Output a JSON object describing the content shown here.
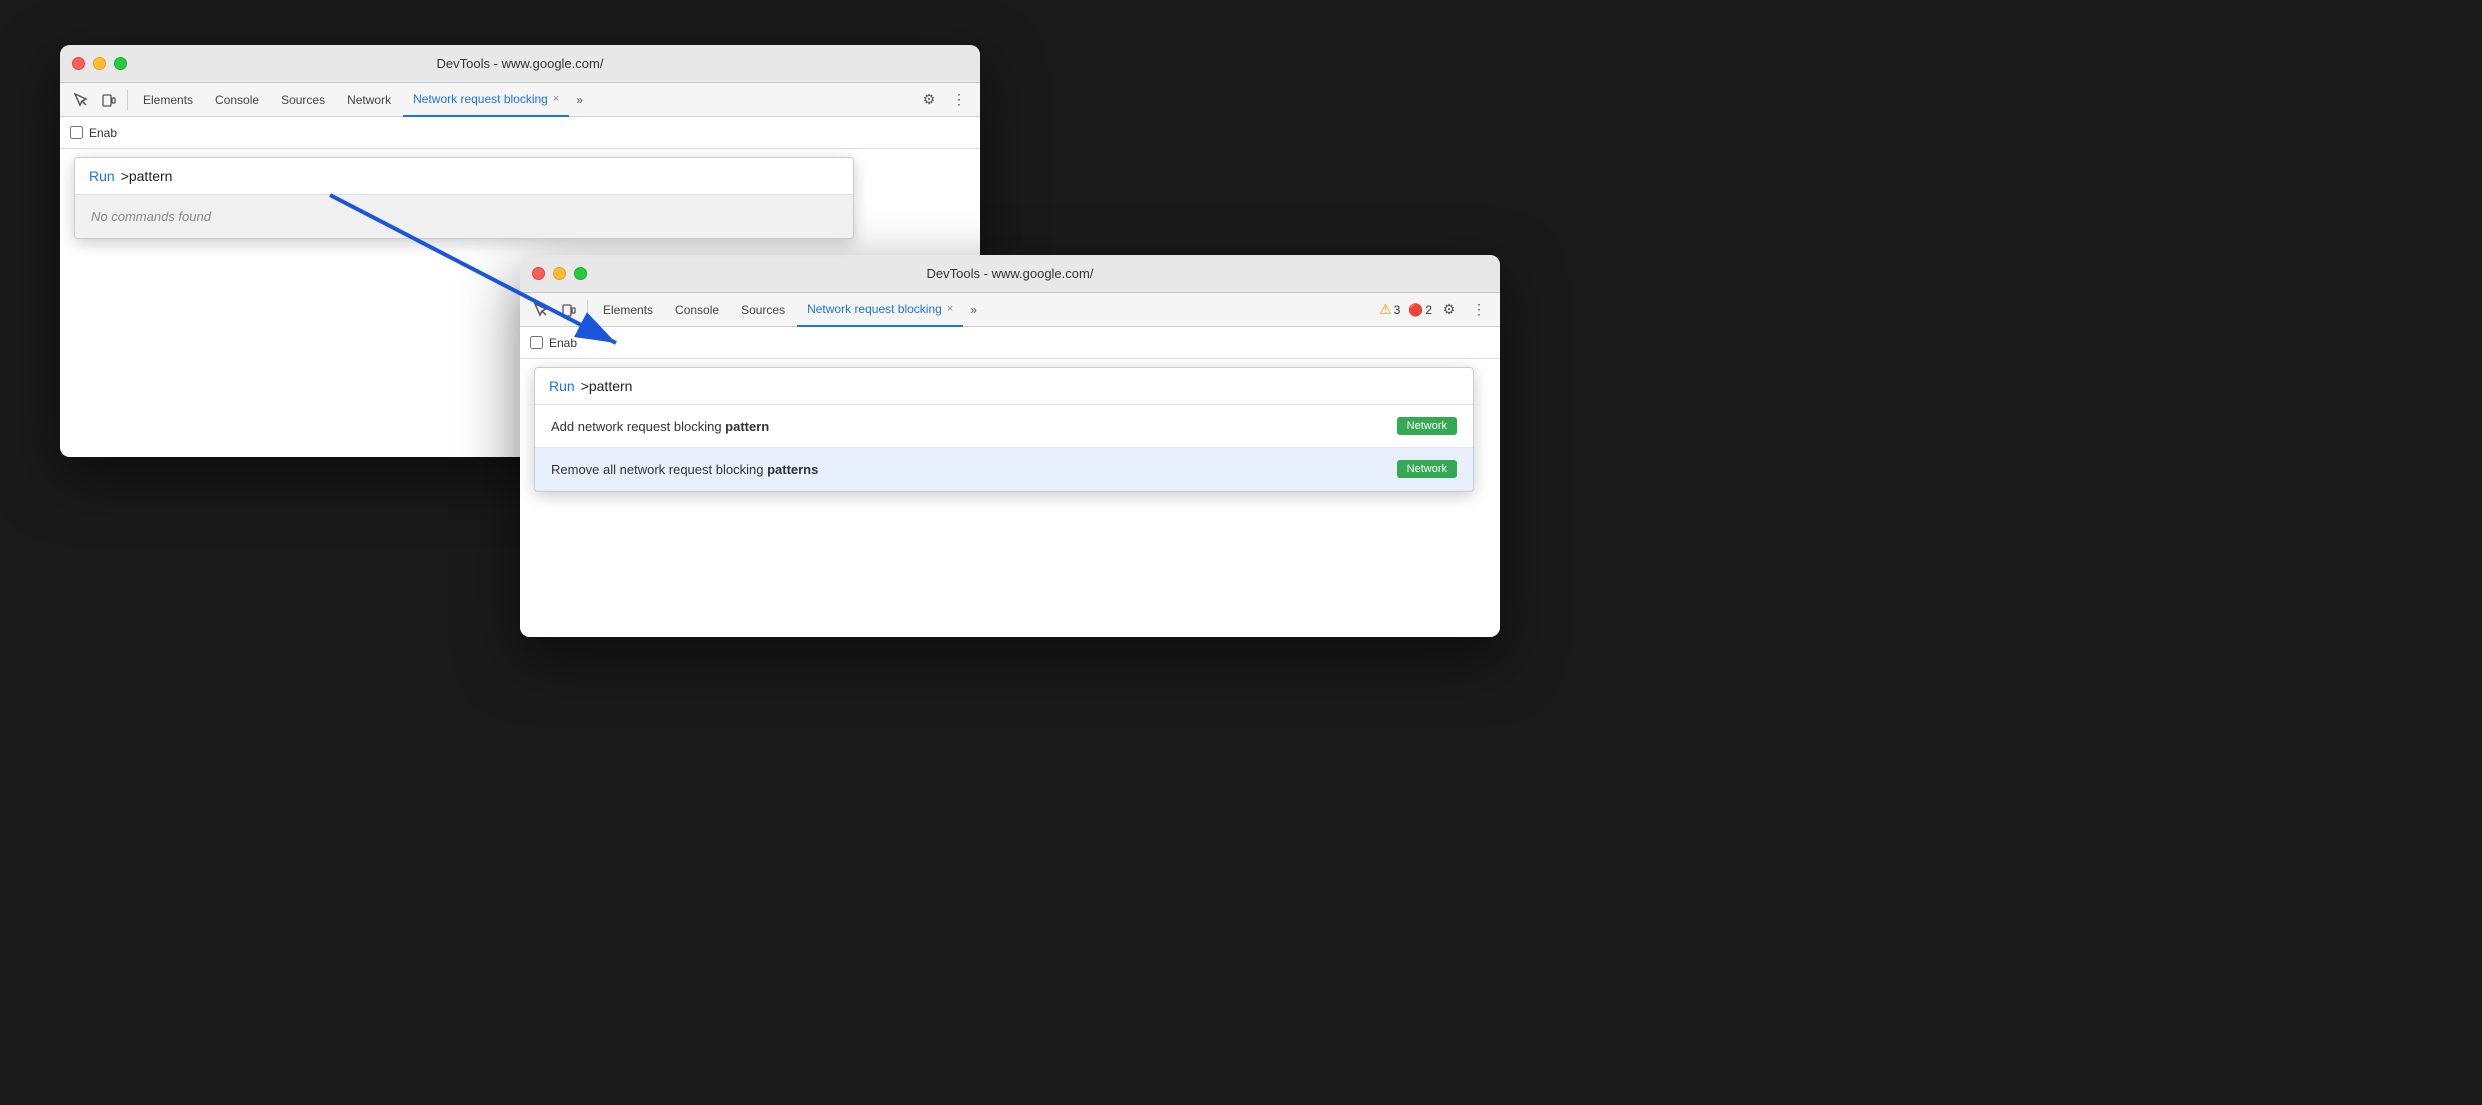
{
  "window1": {
    "title": "DevTools - www.google.com/",
    "tabs": [
      {
        "label": "Elements",
        "active": false
      },
      {
        "label": "Console",
        "active": false
      },
      {
        "label": "Sources",
        "active": false
      },
      {
        "label": "Network",
        "active": false
      },
      {
        "label": "Network request blocking",
        "active": true
      }
    ],
    "enable_label": "Enab",
    "cmd_palette": {
      "run_label": "Run",
      "input_text": ">pattern",
      "no_results": "No commands found"
    }
  },
  "window2": {
    "title": "DevTools - www.google.com/",
    "tabs": [
      {
        "label": "Elements",
        "active": false
      },
      {
        "label": "Console",
        "active": false
      },
      {
        "label": "Sources",
        "active": false
      },
      {
        "label": "Network request blocking",
        "active": true
      }
    ],
    "warning_count": "3",
    "error_count": "2",
    "enable_label": "Enab",
    "cmd_palette": {
      "run_label": "Run",
      "input_text": ">pattern",
      "results": [
        {
          "text_before": "Add network request blocking ",
          "text_bold": "pattern",
          "text_after": "",
          "badge": "Network",
          "highlighted": false
        },
        {
          "text_before": "Remove all network request blocking ",
          "text_bold": "patterns",
          "text_after": "",
          "badge": "Network",
          "highlighted": true
        }
      ]
    }
  },
  "icons": {
    "inspect": "⬚",
    "device": "⊡",
    "more": "⋮",
    "chevron_right": "»",
    "settings": "⚙",
    "close": "×",
    "warning": "⚠",
    "error": "🔴"
  }
}
